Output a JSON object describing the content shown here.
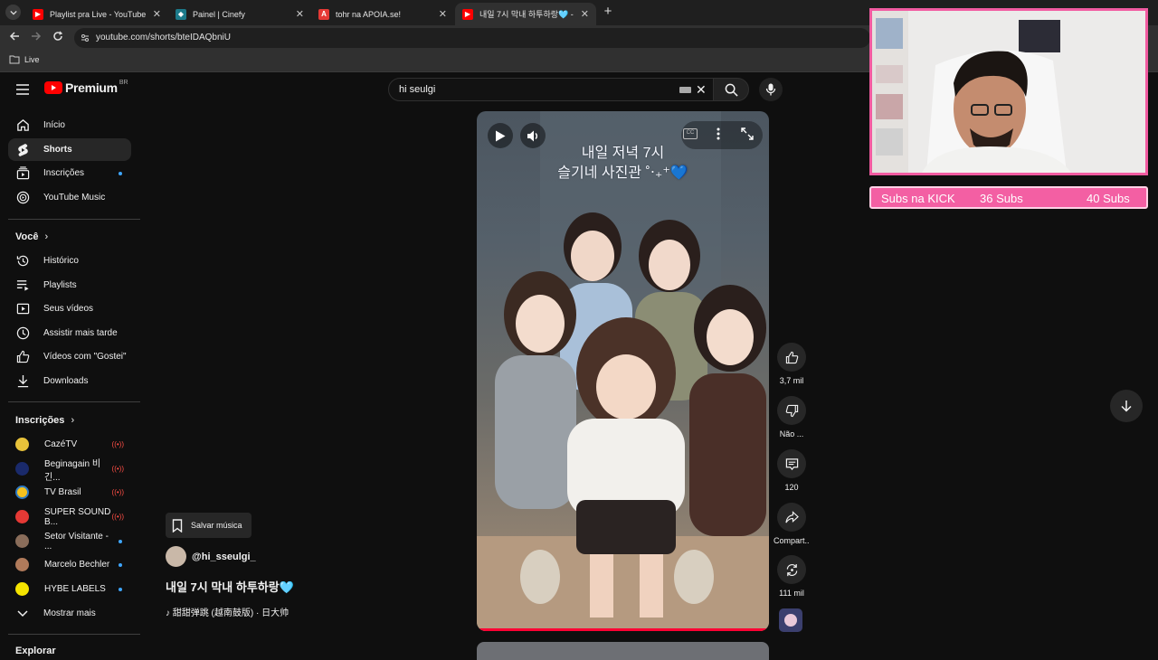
{
  "browser": {
    "tabs": [
      {
        "title": "Playlist pra Live - YouTube",
        "favicon": "youtube-icon"
      },
      {
        "title": "Painel | Cinefy",
        "favicon": "cinefy-icon"
      },
      {
        "title": "tohr na APOIA.se!",
        "favicon": "apoia-icon"
      },
      {
        "title": "내일 7시 막내 하투하랑🩵 - You",
        "favicon": "youtube-icon"
      }
    ],
    "url": "youtube.com/shorts/bteIDAQbniU",
    "bookmarks": [
      {
        "label": "Live"
      }
    ]
  },
  "youtube": {
    "logo_text": "Premium",
    "region": "BR",
    "search_value": "hi seulgi",
    "sidebar": {
      "main": [
        {
          "label": "Início",
          "icon": "home-icon"
        },
        {
          "label": "Shorts",
          "icon": "shorts-icon",
          "active": true
        },
        {
          "label": "Inscrições",
          "icon": "subscriptions-icon",
          "dot": true
        },
        {
          "label": "YouTube Music",
          "icon": "music-icon"
        }
      ],
      "you_title": "Você",
      "you": [
        {
          "label": "Histórico",
          "icon": "history-icon"
        },
        {
          "label": "Playlists",
          "icon": "playlists-icon"
        },
        {
          "label": "Seus vídeos",
          "icon": "your-videos-icon"
        },
        {
          "label": "Assistir mais tarde",
          "icon": "watch-later-icon"
        },
        {
          "label": "Vídeos com \"Gostei\"",
          "icon": "liked-icon"
        },
        {
          "label": "Downloads",
          "icon": "downloads-icon"
        }
      ],
      "subs_title": "Inscrições",
      "subscriptions": [
        {
          "label": "CazéTV",
          "status": "live",
          "color": "#e8c23a"
        },
        {
          "label": "Beginagain 비긴...",
          "status": "live",
          "color": "#1a2a6b"
        },
        {
          "label": "TV Brasil",
          "status": "live",
          "color": "#f4c11e"
        },
        {
          "label": "SUPER SOUND B...",
          "status": "live",
          "color": "#e53935"
        },
        {
          "label": "Setor Visitante - ...",
          "status": "new",
          "color": "#8a6d5a"
        },
        {
          "label": "Marcelo Bechler",
          "status": "new",
          "color": "#b07a5a"
        },
        {
          "label": "HYBE LABELS",
          "status": "new",
          "color": "#f5e400"
        }
      ],
      "show_more": "Mostrar mais",
      "explore_title": "Explorar"
    },
    "short": {
      "overlay_text_line1": "내일 저녁 7시",
      "overlay_text_line2": "슬기네 사진관 ˚‧₊⁺💙",
      "save_music": "Salvar música",
      "channel": "@hi_sseulgi_",
      "title": "내일 7시 막내 하투하랑🩵",
      "music": "♪ 甜甜弹跳 (越南鼓版) · 日大帅",
      "actions": [
        {
          "label": "3,7 mil",
          "icon": "like-icon"
        },
        {
          "label": "Não ...",
          "icon": "dislike-icon"
        },
        {
          "label": "120",
          "icon": "comment-icon"
        },
        {
          "label": "Compart...",
          "icon": "share-icon"
        },
        {
          "label": "111 mil",
          "icon": "remix-icon"
        }
      ]
    }
  },
  "stream_overlay": {
    "subs_label": "Subs na KICK",
    "current": "36 Subs",
    "goal": "40 Subs",
    "accent": "#f35fa3"
  }
}
